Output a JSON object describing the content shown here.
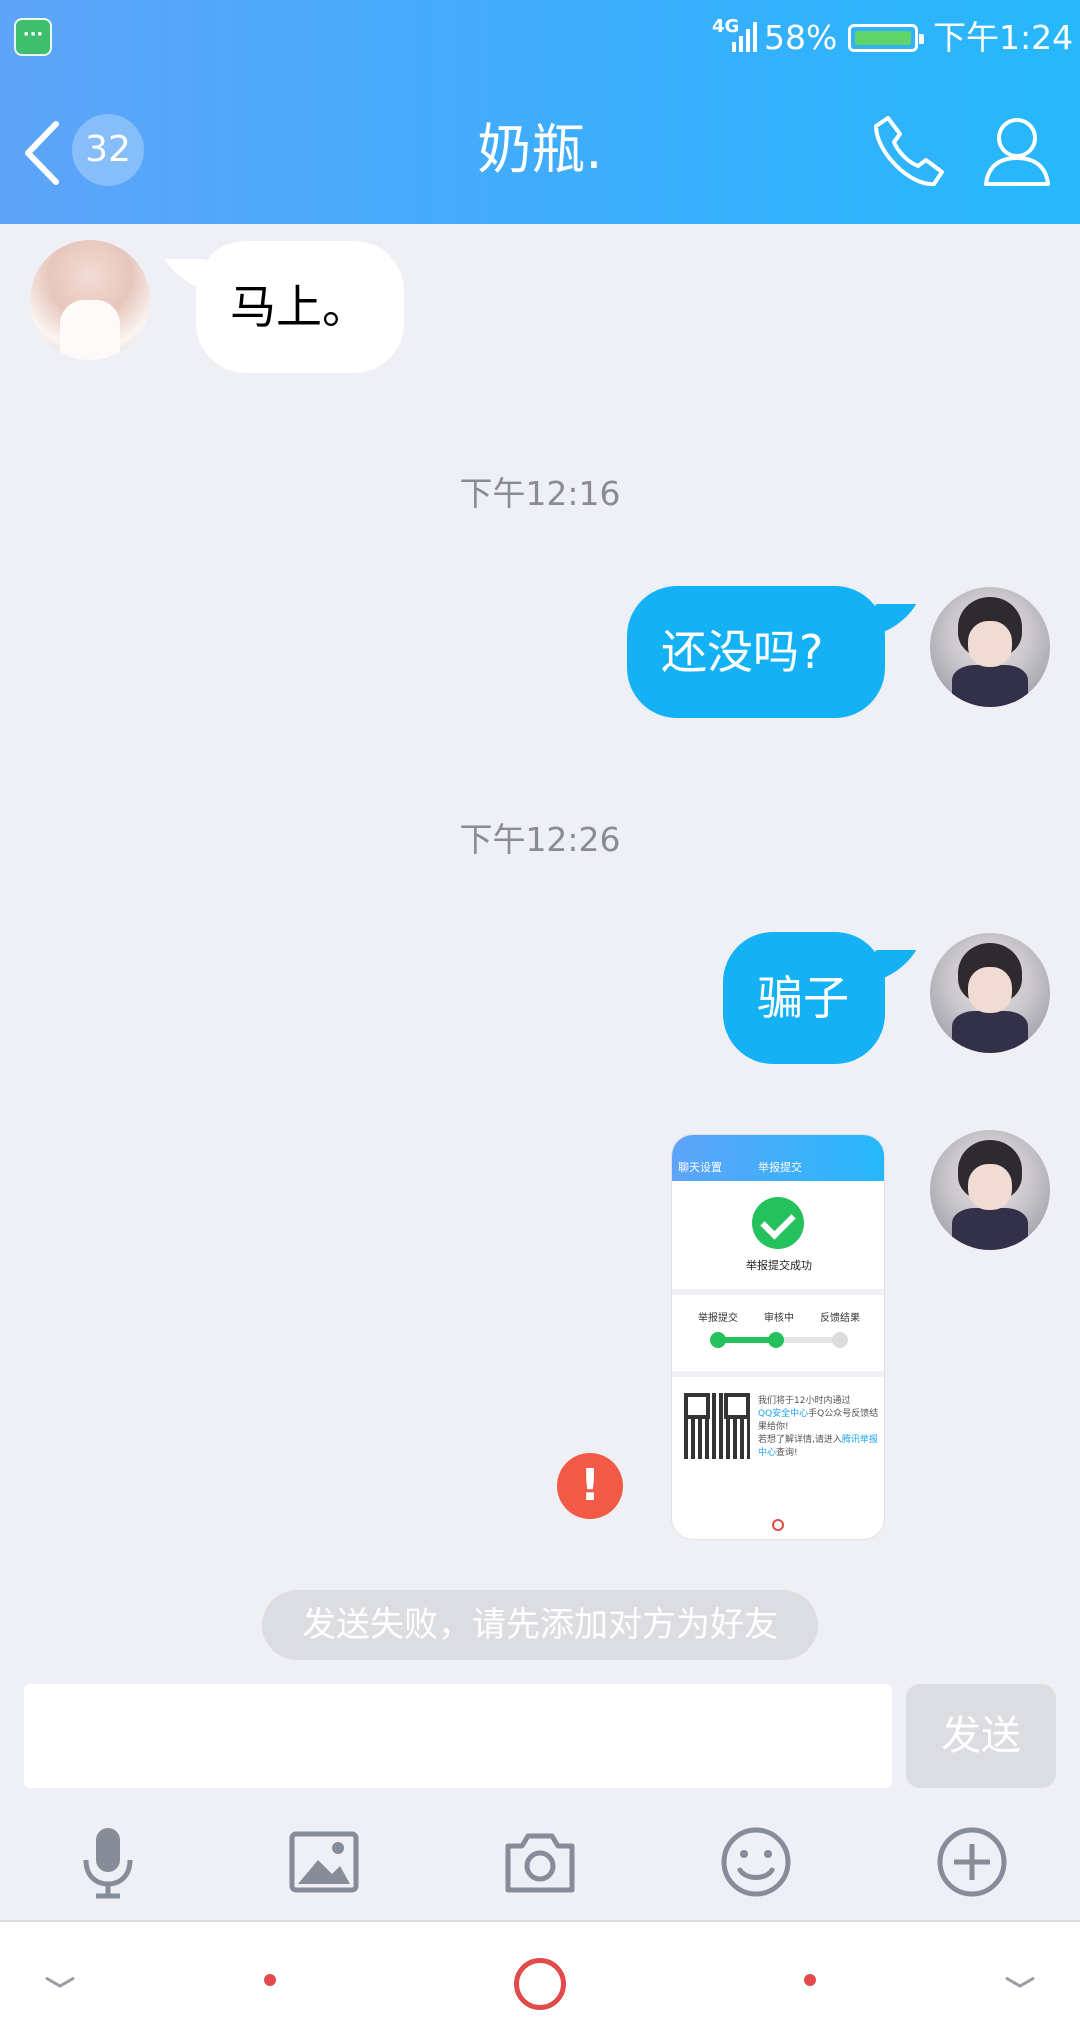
{
  "status_bar": {
    "network": "4G",
    "battery_percent": "58%",
    "time": "下午1:24"
  },
  "header": {
    "unread_count": "32",
    "title": "奶瓶."
  },
  "messages": [
    {
      "direction": "incoming",
      "text": "马上。"
    },
    {
      "timestamp": "下午12:16"
    },
    {
      "direction": "outgoing",
      "text": "还没吗?"
    },
    {
      "timestamp": "下午12:26"
    },
    {
      "direction": "outgoing",
      "text": "骗子"
    },
    {
      "direction": "outgoing",
      "type": "image",
      "status": "failed"
    }
  ],
  "image_preview": {
    "back_label": "聊天设置",
    "page_title": "举报提交",
    "success_text": "举报提交成功",
    "steps": [
      "举报提交",
      "审核中",
      "反馈结果"
    ],
    "info_text_1": "我们将于12小时内通过",
    "info_link_1": "QQ安全中心",
    "info_text_2": "手Q公众号反馈结果给你!",
    "info_text_3": "若想了解详情,请进入",
    "info_link_2": "腾讯举报中心",
    "info_text_4": "查询!"
  },
  "error_mark": "!",
  "notice": "发送失败，请先添加对方为好友",
  "composer": {
    "input_value": "",
    "send_label": "发送"
  },
  "colors": {
    "header_start": "#5ea4f9",
    "header_end": "#26b8fb",
    "outgoing_bubble": "#14b2f5",
    "error": "#f05a47",
    "success": "#24c15d"
  }
}
